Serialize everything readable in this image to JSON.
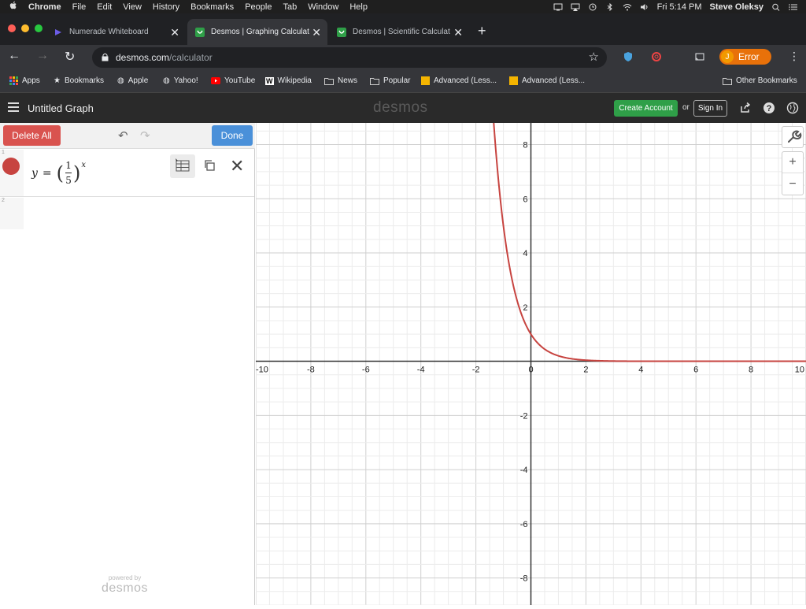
{
  "menubar": {
    "apple": "",
    "app": "Chrome",
    "items": [
      "File",
      "Edit",
      "View",
      "History",
      "Bookmarks",
      "People",
      "Tab",
      "Window",
      "Help"
    ],
    "clock": "Fri 5:14 PM",
    "user": "Steve Oleksy"
  },
  "tabs": [
    {
      "title": "Numerade Whiteboard",
      "active": false
    },
    {
      "title": "Desmos | Graphing Calculat",
      "active": true
    },
    {
      "title": "Desmos | Scientific Calculat",
      "active": false
    }
  ],
  "omnibox": {
    "domain": "desmos.com",
    "path": "/calculator"
  },
  "profile": {
    "initial": "J",
    "label": "Error"
  },
  "bookmarks": [
    "Apps",
    "Bookmarks",
    "Apple",
    "Yahoo!",
    "YouTube",
    "Wikipedia",
    "News",
    "Popular",
    "Advanced (Less...",
    "Advanced (Less..."
  ],
  "other_bookmarks": "Other Bookmarks",
  "desmos": {
    "title": "Untitled Graph",
    "logo": "desmos",
    "create_account": "Create Account",
    "or": "or",
    "sign_in": "Sign In",
    "delete_all": "Delete All",
    "done": "Done",
    "expressions": [
      {
        "index": "1",
        "lhs": "y",
        "num": "1",
        "den": "5",
        "exp": "x",
        "color": "#c74440"
      },
      {
        "index": "2"
      }
    ],
    "powered_small": "powered by",
    "powered_logo": "desmos"
  },
  "chart_data": {
    "type": "line",
    "function": "y = (1/5)^x",
    "xlim": [
      -10,
      10
    ],
    "ylim": [
      -9,
      8.8
    ],
    "xticks": [
      -10,
      -8,
      -6,
      -4,
      -2,
      0,
      2,
      4,
      6,
      8,
      10
    ],
    "yticks": [
      -8,
      -6,
      -4,
      -2,
      2,
      4,
      6,
      8
    ],
    "grid": true,
    "series": [
      {
        "color": "#c74440"
      }
    ]
  }
}
